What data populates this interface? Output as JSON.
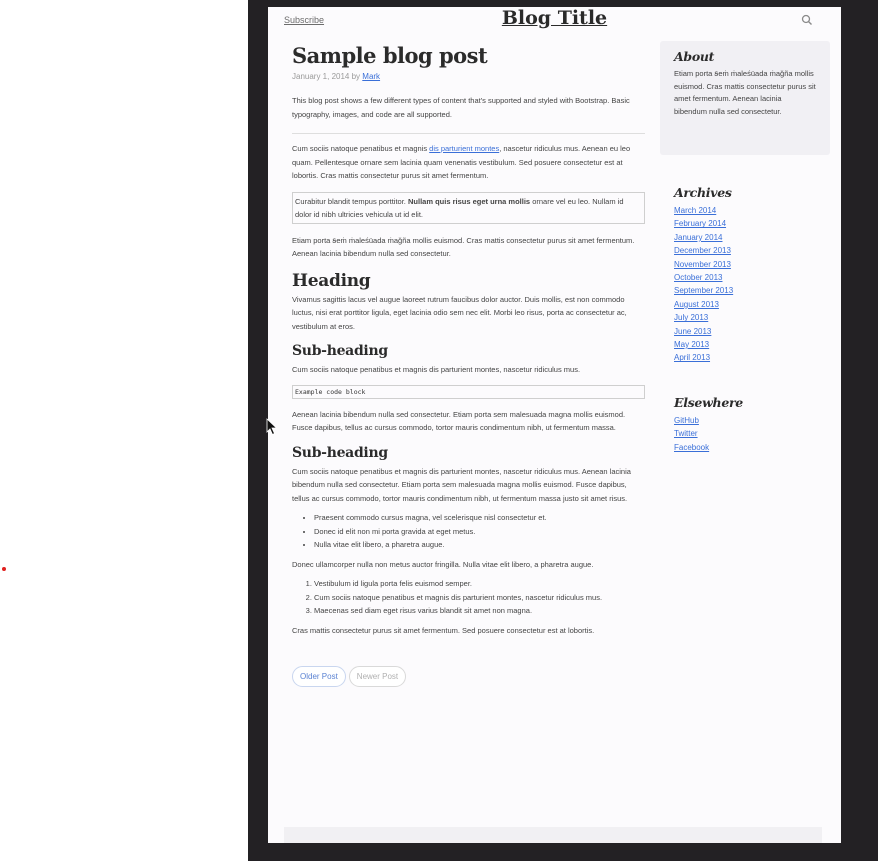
{
  "header": {
    "subscribe": "Subscribe",
    "title": "Blog Title",
    "search_icon": "search-icon"
  },
  "post": {
    "title": "Sample blog post",
    "date": "January 1, 2014 by",
    "author": "Mark",
    "intro": "This blog post shows a few different types of content that's supported and styled with Bootstrap. Basic typography, images, and code are all supported.",
    "p1_before": "Cum sociis natoque penatibus et magnis ",
    "p1_link": "dis parturient montes",
    "p1_after": ", nascetur ridiculus mus. Aenean eu leo quam. Pellentesque ornare sem lacinia quam venenatis vestibulum. Sed posuere consectetur est at lobortis. Cras mattis consectetur purus sit amet fermentum.",
    "quote_before": "Curabitur blandit tempus porttitor. ",
    "quote_bold": "Nullam quis risus eget urna mollis",
    "quote_after": " ornare vel eu leo. Nullam id dolor id nibh ultricies vehicula ut id elit.",
    "p2": "Etiam porta ꞩeṁ ṁaleśüada ṁağña mollis euismod. Cras mattis consectetur purus sit amet fermentum. Aenean lacinia bibendum nulla sed consectetur.",
    "heading": "Heading",
    "p3": "Vivamus sagittis lacus vel augue laoreet rutrum faucibus dolor auctor. Duis mollis, est non commodo luctus, nisi erat porttitor ligula, eget lacinia odio sem nec elit. Morbi leo risus, porta ac consectetur ac, vestibulum at eros.",
    "subheading1": "Sub-heading",
    "p4": "Cum sociis natoque penatibus et magnis dis parturient montes, nascetur ridiculus mus.",
    "code": "Example code block",
    "p5": "Aenean lacinia bibendum nulla sed consectetur. Etiam porta sem malesuada magna mollis euismod. Fusce dapibus, tellus ac cursus commodo, tortor mauris condimentum nibh, ut fermentum massa.",
    "subheading2": "Sub-heading",
    "p6": "Cum sociis natoque penatibus et magnis dis parturient montes, nascetur ridiculus mus. Aenean lacinia bibendum nulla sed consectetur. Etiam porta sem malesuada magna mollis euismod. Fusce dapibus, tellus ac cursus commodo, tortor mauris condimentum nibh, ut fermentum massa justo sit amet risus.",
    "ul": [
      "Praesent commodo cursus magna, vel scelerisque nisl consectetur et.",
      "Donec id elit non mi porta gravida at eget metus.",
      "Nulla vitae elit libero, a pharetra augue."
    ],
    "p7": "Donec ullamcorper nulla non metus auctor fringilla. Nulla vitae elit libero, a pharetra augue.",
    "ol": [
      "Vestibulum id ligula porta felis euismod semper.",
      "Cum sociis natoque penatibus et magnis dis parturient montes, nascetur ridiculus mus.",
      "Maecenas sed diam eget risus varius blandit sit amet non magna."
    ],
    "p8": "Cras mattis consectetur purus sit amet fermentum. Sed posuere consectetur est at lobortis."
  },
  "pager": {
    "older": "Older Post",
    "newer": "Newer Post"
  },
  "sidebar": {
    "about_title": "About",
    "about_text": "Etiam porta ꞩeṁ ṁaleśüada ṁağña mollis euismod. Cras mattis consectetur purus sit amet fermentum. Aenean lacinia bibendum nulla sed consectetur.",
    "archives_title": "Archives",
    "archives": [
      "March 2014",
      "February 2014",
      "January 2014",
      "December 2013",
      "November 2013",
      "October 2013",
      "September 2013",
      "August 2013",
      "July 2013",
      "June 2013",
      "May 2013",
      "April 2013"
    ],
    "elsewhere_title": "Elsewhere",
    "elsewhere": [
      "GitHub",
      "Twitter",
      "Facebook"
    ]
  },
  "colors": {
    "link": "#3a6fd8",
    "frame": "#232124",
    "page_bg": "#fcfbfd",
    "marker_dot": "#e0201e"
  }
}
